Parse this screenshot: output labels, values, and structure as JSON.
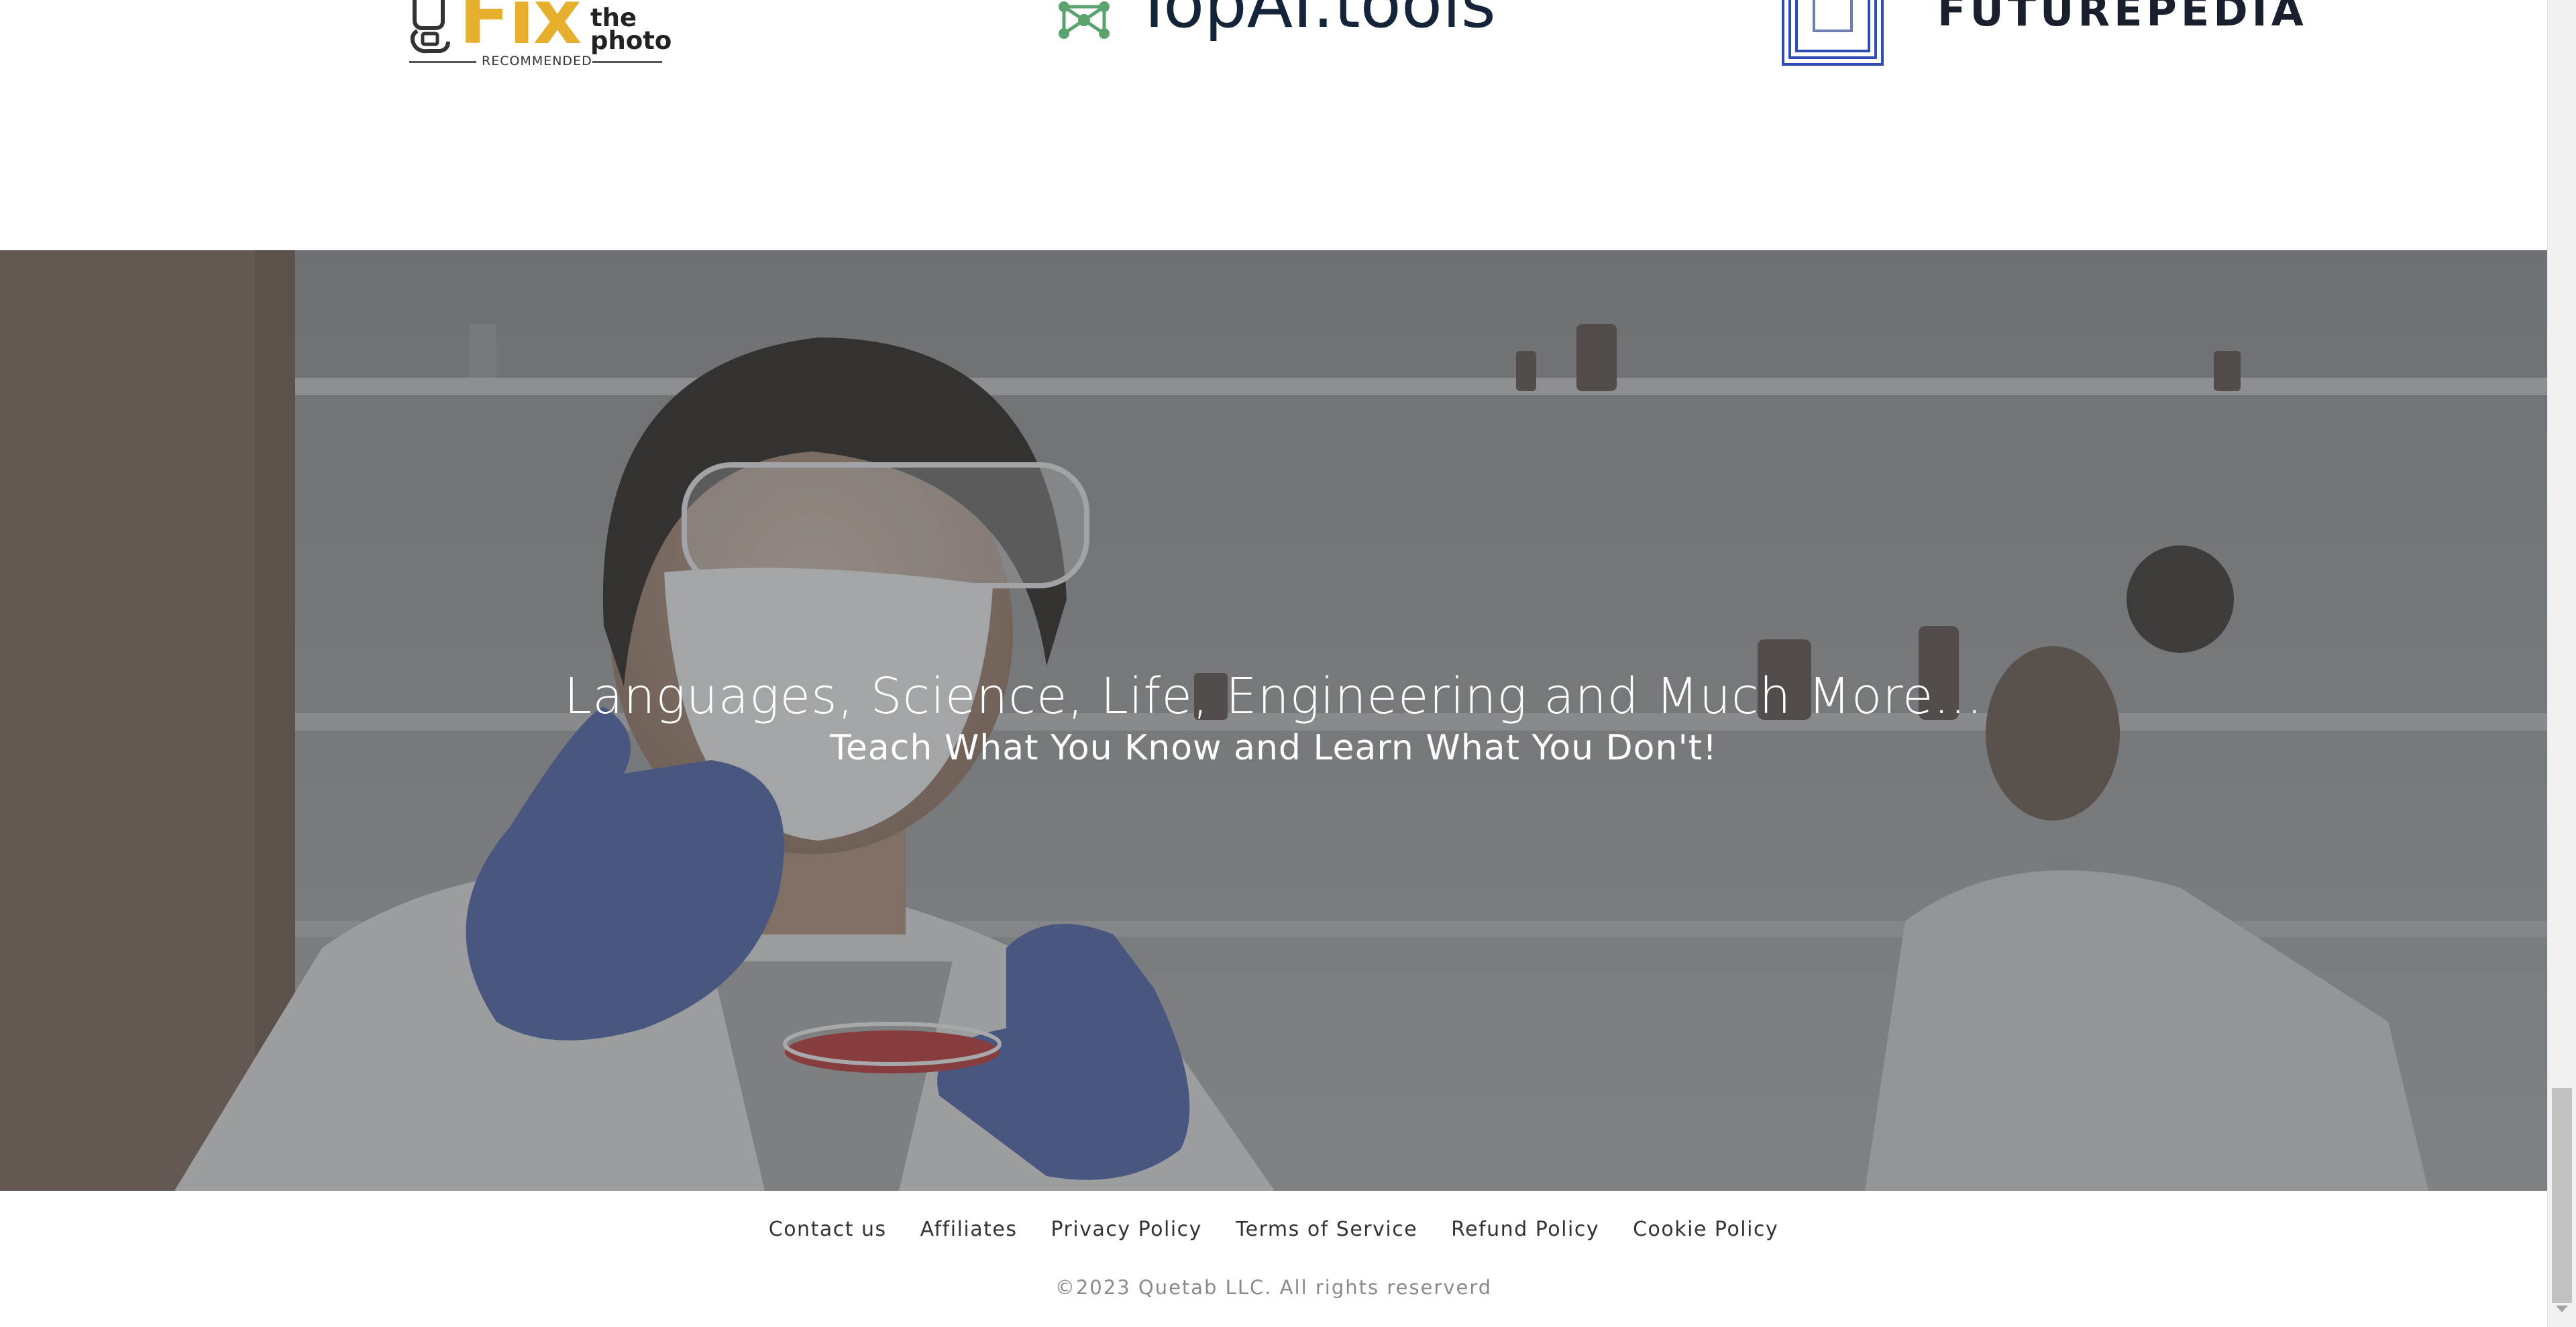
{
  "partner_logos": {
    "fixthephoto": {
      "brand": "Fix",
      "tagline": "the\nphoto",
      "badge": "RECOMMENDED",
      "accent": "#e6b02e"
    },
    "topai": {
      "text": "TopAI.tools",
      "accent": "#5aa36e"
    },
    "futurepedia": {
      "text": "FUTUREPEDIA",
      "accent": "#2f4db0"
    }
  },
  "hero": {
    "title": "Languages, Science, Life, Engineering and Much More...",
    "subtitle": "Teach What You Know and Learn What You Don't!"
  },
  "footer": {
    "links": [
      {
        "label": "Contact us"
      },
      {
        "label": "Affiliates"
      },
      {
        "label": "Privacy Policy"
      },
      {
        "label": "Terms of Service"
      },
      {
        "label": "Refund Policy"
      },
      {
        "label": "Cookie Policy"
      }
    ],
    "copyright": "©2023 Quetab LLC. All rights reserverd"
  },
  "scrollbar": {
    "scroll_position": 0.97
  }
}
